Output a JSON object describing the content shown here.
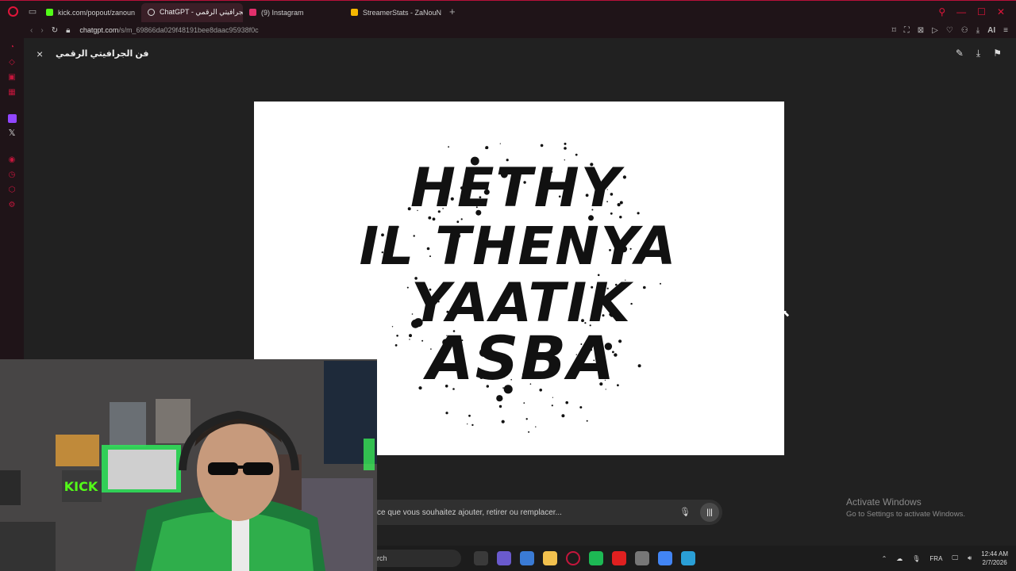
{
  "browser": {
    "tabs": [
      {
        "label": "kick.com/popout/zanoun",
        "color": "#53fc18",
        "active": false
      },
      {
        "label": "ChatGPT - الجرافيتي الرقمي",
        "color": "#e0e0e0",
        "active": true
      },
      {
        "label": "(9) Instagram",
        "color": "#e1306c",
        "active": false
      },
      {
        "label": "StreamerStats - ZaNouN",
        "color": "#f5b700",
        "active": false
      }
    ],
    "new_tab": "+",
    "url_host": "chatgpt.com",
    "url_path": "/s/m_69866da029f48191bee8daac95938f0c",
    "ai_label": "AI"
  },
  "viewer": {
    "title": "فن الجرافيتي الرقمي",
    "close_icon": "×",
    "graffiti_lines": [
      "HETHY",
      "IL THENYA",
      "YAATIK",
      "ASBA"
    ],
    "prompt_placeholder": "ce que vous souhaitez ajouter, retirer ou remplacer..."
  },
  "watermark": {
    "line1": "Activate Windows",
    "line2": "Go to Settings to activate Windows."
  },
  "taskbar": {
    "search_stub": "rch",
    "lang": "FRA",
    "time": "12:44 AM",
    "date": "2/7/2026",
    "apps": [
      "#3a3a3a",
      "#6a5acd",
      "#3a7bd5",
      "#f2c14e",
      "#c4163c",
      "#1db954",
      "#e02020",
      "#777777",
      "#4285f4",
      "#2a9fd6"
    ]
  },
  "colors": {
    "accent": "#e0153a",
    "viewer_bg": "#212121"
  }
}
